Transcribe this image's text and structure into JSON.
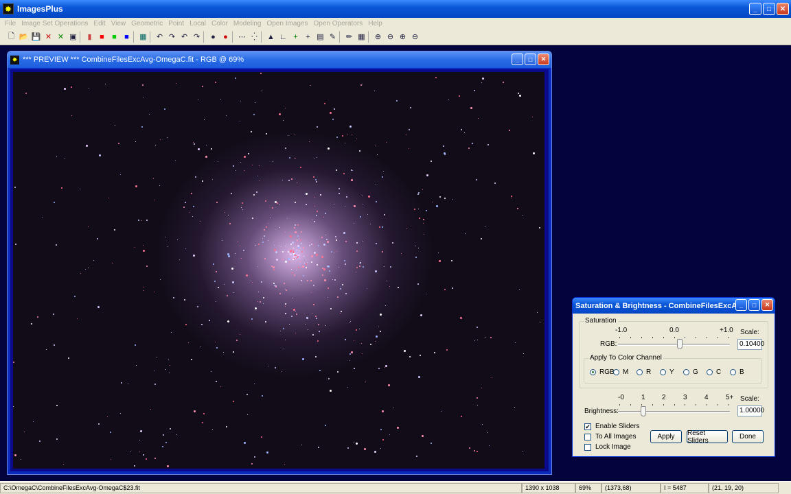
{
  "app": {
    "title": "ImagesPlus",
    "icon": "app-star-icon"
  },
  "menu": [
    "File",
    "Image Set Operations",
    "Edit",
    "View",
    "Geometric",
    "Point",
    "Local",
    "Color",
    "Modeling",
    "Open Images",
    "Open Operators",
    "Help"
  ],
  "toolbar": [
    {
      "name": "new-icon",
      "glyph": "🗋"
    },
    {
      "name": "open-icon",
      "glyph": "📂"
    },
    {
      "name": "save-icon",
      "glyph": "💾"
    },
    {
      "name": "close-red-icon",
      "glyph": "✕"
    },
    {
      "name": "close-green-icon",
      "glyph": "✕"
    },
    {
      "name": "copy-icon",
      "glyph": "▣"
    },
    {
      "sep": true
    },
    {
      "name": "rgb-channel-icon",
      "glyph": "▮"
    },
    {
      "name": "red-channel-icon",
      "glyph": "■"
    },
    {
      "name": "green-channel-icon",
      "glyph": "■"
    },
    {
      "name": "blue-channel-icon",
      "glyph": "■"
    },
    {
      "sep": true
    },
    {
      "name": "grid-icon",
      "glyph": "▦"
    },
    {
      "sep": true
    },
    {
      "name": "undo-icon",
      "glyph": "↶"
    },
    {
      "name": "redo-icon",
      "glyph": "↷"
    },
    {
      "name": "undo-all-icon",
      "glyph": "↶"
    },
    {
      "name": "redo-all-icon",
      "glyph": "↷"
    },
    {
      "sep": true
    },
    {
      "name": "circle-select-icon",
      "glyph": "●"
    },
    {
      "name": "circle-red-icon",
      "glyph": "●"
    },
    {
      "sep": true
    },
    {
      "name": "dots-icon",
      "glyph": "⋯"
    },
    {
      "name": "scatter-icon",
      "glyph": "⁛"
    },
    {
      "sep": true
    },
    {
      "name": "histogram-icon",
      "glyph": "▲"
    },
    {
      "name": "curve-icon",
      "glyph": "∟"
    },
    {
      "name": "crosshair-green-icon",
      "glyph": "+"
    },
    {
      "name": "crosshair-icon",
      "glyph": "+"
    },
    {
      "name": "calculator-icon",
      "glyph": "▤"
    },
    {
      "name": "paint-icon",
      "glyph": "✎"
    },
    {
      "sep": true
    },
    {
      "name": "pencil-icon",
      "glyph": "✏"
    },
    {
      "name": "table-icon",
      "glyph": "▦"
    },
    {
      "sep": true
    },
    {
      "name": "zoom-in-icon",
      "glyph": "⊕"
    },
    {
      "name": "zoom-out-icon",
      "glyph": "⊖"
    },
    {
      "name": "zoom-fit-icon",
      "glyph": "⊕"
    },
    {
      "name": "zoom-actual-icon",
      "glyph": "⊖"
    }
  ],
  "preview": {
    "title": "*** PREVIEW *** CombineFilesExcAvg-OmegaC.fit - RGB @ 69%"
  },
  "dialog": {
    "title": "Saturation & Brightness - CombineFilesExcAv...",
    "saturation_group": "Saturation",
    "sat_ticks": [
      "-1.0",
      "0.0",
      "+1.0"
    ],
    "sat_scale_label": "Scale:",
    "rgb_label": "RGB:",
    "sat_scale_value": "0.10400",
    "sat_level": 0.1,
    "channel_group": "Apply To Color Channel",
    "channels": [
      "RGB",
      "M",
      "R",
      "Y",
      "G",
      "C",
      "B"
    ],
    "selected_channel": "RGB",
    "bright_ticks": [
      "-0",
      "1",
      "2",
      "3",
      "4",
      "5+"
    ],
    "bright_scale_label": "Scale:",
    "brightness_label": "Brightness:",
    "bright_scale_value": "1.00000",
    "bright_level": 1,
    "checks": [
      {
        "label": "Enable Sliders",
        "checked": true
      },
      {
        "label": "To All Images",
        "checked": false
      },
      {
        "label": "Lock Image",
        "checked": false
      }
    ],
    "apply_label": "Apply",
    "reset_label": "Reset Sliders",
    "done_label": "Done"
  },
  "status": {
    "path": "C:\\OmegaC\\CombineFilesExcAvg-OmegaC$23.fit",
    "dims": "1390 x 1038",
    "zoom": "69%",
    "coords": "(1373,68)",
    "intensity": "I = 5487",
    "rgb": "(21, 19, 20)"
  }
}
